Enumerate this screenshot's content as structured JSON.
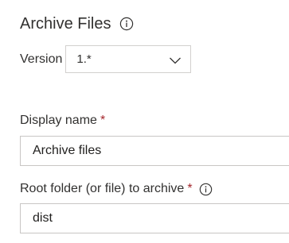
{
  "task": {
    "title": "Archive Files",
    "title_icon": "info-icon"
  },
  "version": {
    "label": "Version",
    "selected": "1.*",
    "icon": "chevron-down-icon"
  },
  "fields": {
    "display_name": {
      "label": "Display name",
      "required_mark": "*",
      "value": "Archive files"
    },
    "root_folder": {
      "label": "Root folder (or file) to archive",
      "required_mark": "*",
      "icon": "info-icon",
      "value": "dist"
    }
  },
  "colors": {
    "text": "#323130",
    "required": "#a4262c",
    "border": "#c8c6c4"
  }
}
